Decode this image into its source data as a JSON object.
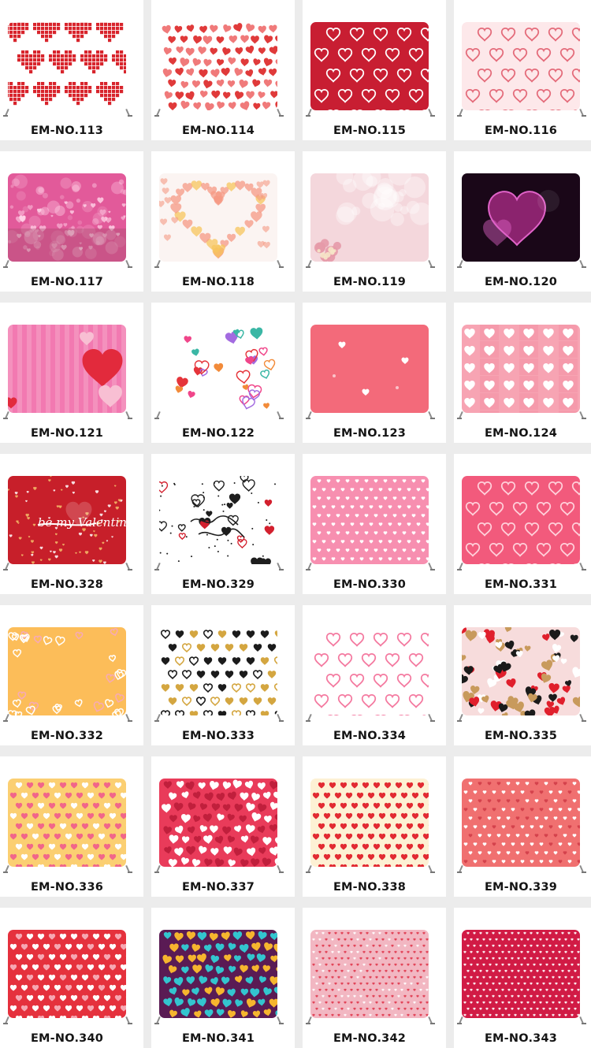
{
  "products": [
    {
      "code": "EM-NO.113",
      "style": "pixel",
      "bg": "#ffffff",
      "fg": "#d8242c",
      "fg2": "#ffffff"
    },
    {
      "code": "EM-NO.114",
      "style": "dense",
      "bg": "#ffffff",
      "fg": "#e03a3a",
      "fg2": "#f07a7a"
    },
    {
      "code": "EM-NO.115",
      "style": "outline",
      "bg": "#c81e32",
      "fg": "#ffffff",
      "fg2": "#ffffff"
    },
    {
      "code": "EM-NO.116",
      "style": "outline",
      "bg": "#fde8ea",
      "fg": "#e46b7a",
      "fg2": "#e46b7a"
    },
    {
      "code": "EM-NO.117",
      "style": "bokeh",
      "bg": "#e25a9a",
      "fg": "#ffd1e6",
      "fg2": "#9e4a66"
    },
    {
      "code": "EM-NO.118",
      "style": "ring",
      "bg": "#fbf4f2",
      "fg": "#f59a84",
      "fg2": "#f7c65c"
    },
    {
      "code": "EM-NO.119",
      "style": "soft",
      "bg": "#f4d7dc",
      "fg": "#ffffff",
      "fg2": "#e59aa8"
    },
    {
      "code": "EM-NO.120",
      "style": "bigdark",
      "bg": "#1a0718",
      "fg": "#a0287e",
      "fg2": "#e063c8"
    },
    {
      "code": "EM-NO.121",
      "style": "stripes",
      "bg": "#f279b1",
      "fg": "#e22a3c",
      "fg2": "#f8bfd3"
    },
    {
      "code": "EM-NO.122",
      "style": "doodle",
      "bg": "#ffffff",
      "fg": "#f0468a",
      "fg2": "#a36be0"
    },
    {
      "code": "EM-NO.123",
      "style": "sparse",
      "bg": "#f36a7a",
      "fg": "#ffffff",
      "fg2": "#ffffff"
    },
    {
      "code": "EM-NO.124",
      "style": "grid",
      "bg": "#f7a4b3",
      "fg": "#ffffff",
      "fg2": "#f06f88"
    },
    {
      "code": "EM-NO.328",
      "style": "valentine",
      "bg": "#c71f2a",
      "fg": "#f4c06a",
      "fg2": "#ffffff"
    },
    {
      "code": "EM-NO.329",
      "style": "bridal",
      "bg": "#ffffff",
      "fg": "#1e1e1e",
      "fg2": "#d3202e"
    },
    {
      "code": "EM-NO.330",
      "style": "small",
      "bg": "#f78fb0",
      "fg": "#ffffff",
      "fg2": "#ffffff"
    },
    {
      "code": "EM-NO.331",
      "style": "outline",
      "bg": "#f25a7c",
      "fg": "#ffd0da",
      "fg2": "#ffd0da"
    },
    {
      "code": "EM-NO.332",
      "style": "border",
      "bg": "#fcbd59",
      "fg": "#ffffff",
      "fg2": "#f7a9b8"
    },
    {
      "code": "EM-NO.333",
      "style": "mixed",
      "bg": "#ffffff",
      "fg": "#1b1b1b",
      "fg2": "#d4a640"
    },
    {
      "code": "EM-NO.334",
      "style": "outline",
      "bg": "#ffffff",
      "fg": "#f47aa0",
      "fg2": "#f47aa0"
    },
    {
      "code": "EM-NO.335",
      "style": "confetti",
      "bg": "#f7dcdc",
      "fg": "#1b1b1b",
      "fg2": "#e01f2c"
    },
    {
      "code": "EM-NO.336",
      "style": "rows",
      "bg": "#fbcf72",
      "fg": "#f1668a",
      "fg2": "#ffffff"
    },
    {
      "code": "EM-NO.337",
      "style": "dense",
      "bg": "#e93b5a",
      "fg": "#ffffff",
      "fg2": "#c01f3c"
    },
    {
      "code": "EM-NO.338",
      "style": "rows",
      "bg": "#fdf1d4",
      "fg": "#e22a32",
      "fg2": "#e22a32"
    },
    {
      "code": "EM-NO.339",
      "style": "small",
      "bg": "#f07070",
      "fg": "#ffffff",
      "fg2": "#d4424c"
    },
    {
      "code": "EM-NO.340",
      "style": "rows",
      "bg": "#e5313d",
      "fg": "#ffffff",
      "fg2": "#f6a7b2"
    },
    {
      "code": "EM-NO.341",
      "style": "dense",
      "bg": "#5a1b54",
      "fg": "#f6b52e",
      "fg2": "#33c5cf"
    },
    {
      "code": "EM-NO.342",
      "style": "tiny",
      "bg": "#f2b7c2",
      "fg": "#e0384e",
      "fg2": "#ffffff"
    },
    {
      "code": "EM-NO.343",
      "style": "tiny",
      "bg": "#d11b45",
      "fg": "#ffffff",
      "fg2": "#ffffff"
    }
  ]
}
